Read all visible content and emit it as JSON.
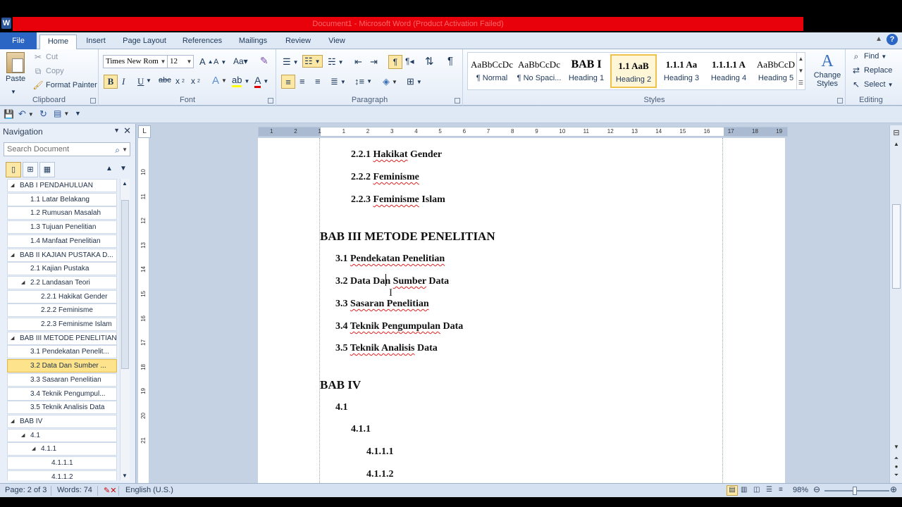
{
  "window": {
    "title": "Document1 - Microsoft Word (Product Activation Failed)",
    "app_icon": "W"
  },
  "tabs": [
    {
      "label": "File"
    },
    {
      "label": "Home"
    },
    {
      "label": "Insert"
    },
    {
      "label": "Page Layout"
    },
    {
      "label": "References"
    },
    {
      "label": "Mailings"
    },
    {
      "label": "Review"
    },
    {
      "label": "View"
    }
  ],
  "ribbon": {
    "clipboard": {
      "paste": "Paste",
      "cut": "Cut",
      "copy": "Copy",
      "format_painter": "Format Painter",
      "label": "Clipboard"
    },
    "font": {
      "family": "Times New Rom",
      "size": "12",
      "label": "Font"
    },
    "paragraph": {
      "label": "Paragraph"
    },
    "styles": {
      "label": "Styles",
      "items": [
        {
          "preview": "AaBbCcDc",
          "name": "¶ Normal"
        },
        {
          "preview": "AaBbCcDc",
          "name": "¶ No Spaci..."
        },
        {
          "preview": "BAB I",
          "name": "Heading 1"
        },
        {
          "preview": "1.1 AaB",
          "name": "Heading 2"
        },
        {
          "preview": "1.1.1 Aa",
          "name": "Heading 3"
        },
        {
          "preview": "1.1.1.1 A",
          "name": "Heading 4"
        },
        {
          "preview": "AaBbCcD",
          "name": "Heading 5"
        }
      ],
      "change_styles": "Change Styles"
    },
    "editing": {
      "find": "Find",
      "replace": "Replace",
      "select": "Select",
      "label": "Editing"
    }
  },
  "navigation": {
    "title": "Navigation",
    "search_placeholder": "Search Document",
    "items": [
      {
        "label": "BAB I  PENDAHULUAN",
        "level": 1,
        "expanded": true
      },
      {
        "label": "1.1 Latar Belakang",
        "level": 2
      },
      {
        "label": "1.2 Rumusan Masalah",
        "level": 2
      },
      {
        "label": "1.3 Tujuan Penelitian",
        "level": 2
      },
      {
        "label": "1.4 Manfaat Penelitian",
        "level": 2
      },
      {
        "label": "BAB II  KAJIAN PUSTAKA D...",
        "level": 1,
        "expanded": true
      },
      {
        "label": "2.1 Kajian Pustaka",
        "level": 2
      },
      {
        "label": "2.2 Landasan Teori",
        "level": 2,
        "expanded": true
      },
      {
        "label": "2.2.1 Hakikat Gender",
        "level": 3
      },
      {
        "label": "2.2.2 Feminisme",
        "level": 3
      },
      {
        "label": "2.2.3 Feminisme Islam",
        "level": 3
      },
      {
        "label": "BAB III  METODE PENELITIAN",
        "level": 1,
        "expanded": true
      },
      {
        "label": "3.1 Pendekatan Penelit...",
        "level": 2
      },
      {
        "label": "3.2 Data Dan Sumber ...",
        "level": 2,
        "selected": true
      },
      {
        "label": "3.3 Sasaran Penelitian",
        "level": 2
      },
      {
        "label": "3.4 Teknik Pengumpul...",
        "level": 2
      },
      {
        "label": "3.5 Teknik Analisis Data",
        "level": 2
      },
      {
        "label": "BAB IV",
        "level": 1,
        "expanded": true
      },
      {
        "label": "4.1",
        "level": 2,
        "expanded": true
      },
      {
        "label": "4.1.1",
        "level": 3,
        "expanded": true
      },
      {
        "label": "4.1.1.1",
        "level": 4
      },
      {
        "label": "4.1.1.2",
        "level": 4
      }
    ]
  },
  "document": {
    "lines": [
      {
        "text": "2.2.1 ",
        "sq": "Hakikat",
        "rest": " Gender",
        "style": "h3"
      },
      {
        "text": "2.2.2 ",
        "sq": "Feminisme",
        "rest": "",
        "style": "h3"
      },
      {
        "text": "2.2.3 ",
        "sq": "Feminisme",
        "rest": " Islam",
        "style": "h3"
      },
      {
        "text": "BAB III METODE PENELITIAN",
        "sq": "",
        "rest": "",
        "style": "h1"
      },
      {
        "text": "3.1 ",
        "sq": "Pendekatan Penelitian",
        "rest": "",
        "style": "h2"
      },
      {
        "text": "3.2 Data Dan ",
        "sq": "Sumber",
        "rest": " Data",
        "style": "h2"
      },
      {
        "text": "3.3 ",
        "sq": "Sasaran Penelitian",
        "rest": "",
        "style": "h2"
      },
      {
        "text": "3.4 ",
        "sq": "Teknik Pengumpulan",
        "rest": " Data",
        "style": "h2"
      },
      {
        "text": "3.5 ",
        "sq": "Teknik Analisis",
        "rest": " Data",
        "style": "h2"
      },
      {
        "text": "BAB IV",
        "sq": "",
        "rest": "",
        "style": "h1"
      },
      {
        "text": "4.1",
        "sq": "",
        "rest": "",
        "style": "h2"
      },
      {
        "text": "4.1.1",
        "sq": "",
        "rest": "",
        "style": "h3"
      },
      {
        "text": "4.1.1.1",
        "sq": "",
        "rest": "",
        "style": "h4"
      },
      {
        "text": "4.1.1.2",
        "sq": "",
        "rest": "",
        "style": "h4"
      }
    ]
  },
  "ruler": {
    "numbers": [
      "1",
      "2",
      "1",
      "1",
      "2",
      "3",
      "4",
      "5",
      "6",
      "7",
      "8",
      "9",
      "10",
      "11",
      "12",
      "13",
      "14",
      "15",
      "16",
      "17",
      "18",
      "19"
    ]
  },
  "vruler": {
    "numbers": [
      "10",
      "11",
      "12",
      "13",
      "14",
      "15",
      "16",
      "17",
      "18",
      "19",
      "20",
      "21"
    ]
  },
  "status": {
    "page": "Page: 2 of 3",
    "words": "Words: 74",
    "language": "English (U.S.)",
    "zoom": "98%"
  }
}
